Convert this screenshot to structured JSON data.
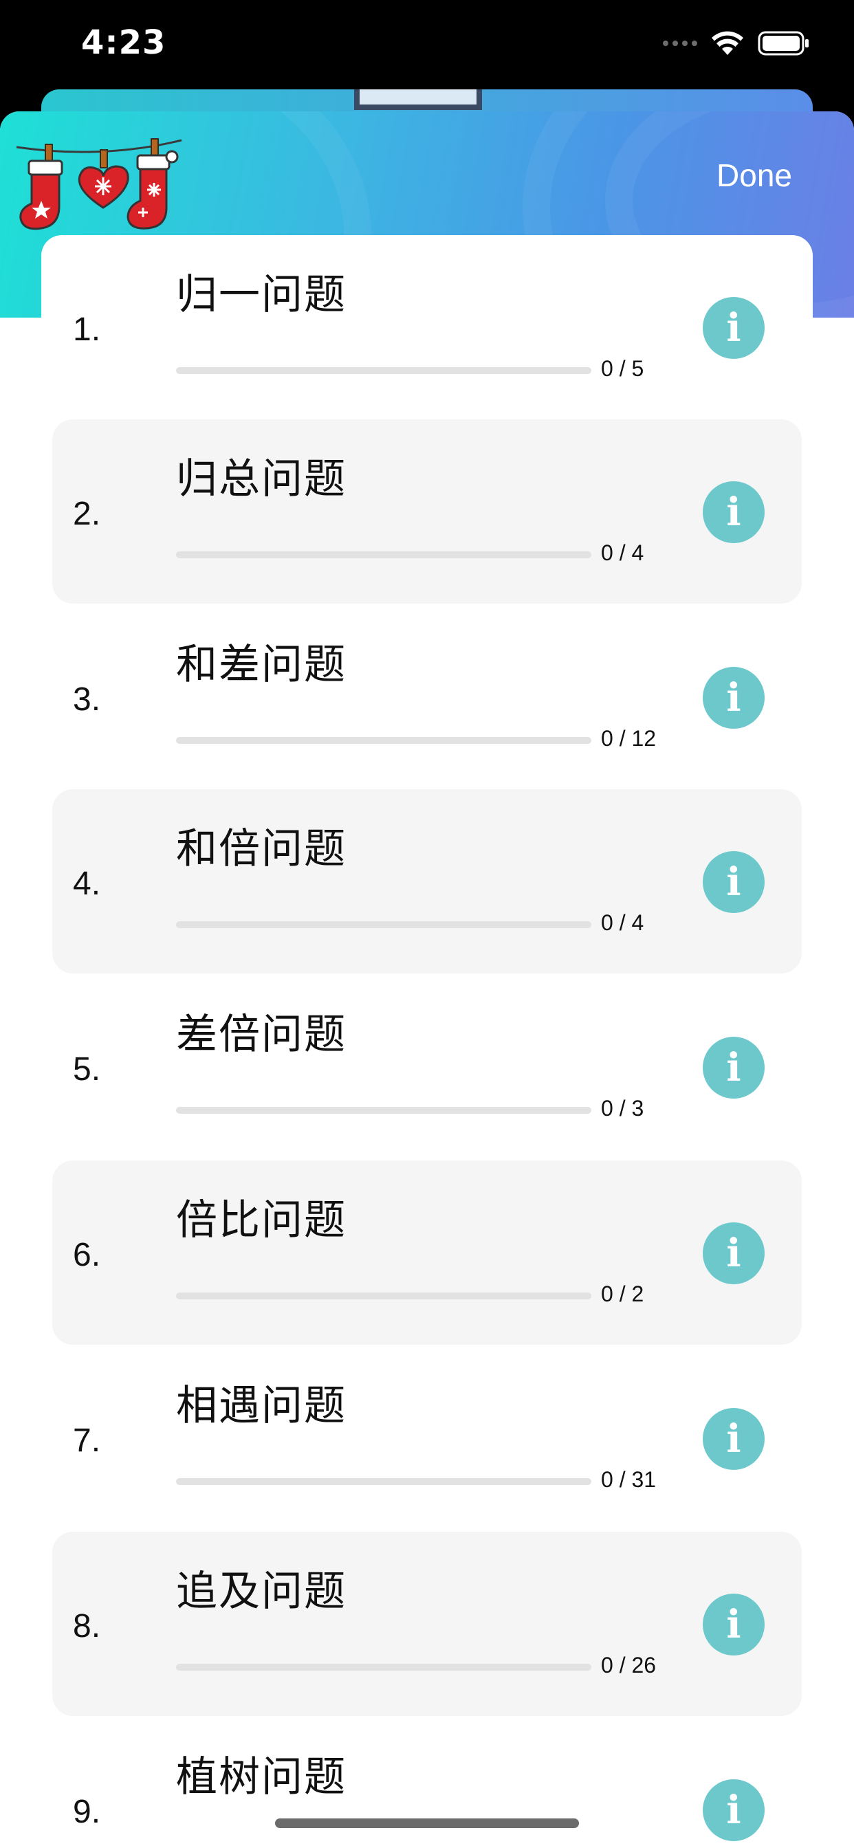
{
  "status_bar": {
    "time": "4:23"
  },
  "header": {
    "done_label": "Done"
  },
  "colors": {
    "header_gradient_start": "#1ee0d6",
    "header_gradient_end": "#6b7fe6",
    "info_button": "#6cc8cb",
    "row_shade": "#f5f5f5",
    "progress_track": "#e2e2e2"
  },
  "list": {
    "items": [
      {
        "number": "1.",
        "title": "归一问题",
        "count": "0 / 5",
        "progress": 0,
        "icon": "info-icon"
      },
      {
        "number": "2.",
        "title": "归总问题",
        "count": "0 / 4",
        "progress": 0,
        "icon": "info-icon"
      },
      {
        "number": "3.",
        "title": "和差问题",
        "count": "0 / 12",
        "progress": 0,
        "icon": "info-icon"
      },
      {
        "number": "4.",
        "title": "和倍问题",
        "count": "0 / 4",
        "progress": 0,
        "icon": "info-icon"
      },
      {
        "number": "5.",
        "title": "差倍问题",
        "count": "0 / 3",
        "progress": 0,
        "icon": "info-icon"
      },
      {
        "number": "6.",
        "title": "倍比问题",
        "count": "0 / 2",
        "progress": 0,
        "icon": "info-icon"
      },
      {
        "number": "7.",
        "title": "相遇问题",
        "count": "0 / 31",
        "progress": 0,
        "icon": "info-icon"
      },
      {
        "number": "8.",
        "title": "追及问题",
        "count": "0 / 26",
        "progress": 0,
        "icon": "info-icon"
      },
      {
        "number": "9.",
        "title": "植树问题",
        "count": "",
        "progress": 0,
        "icon": "info-icon"
      }
    ],
    "info_glyph": "i"
  }
}
